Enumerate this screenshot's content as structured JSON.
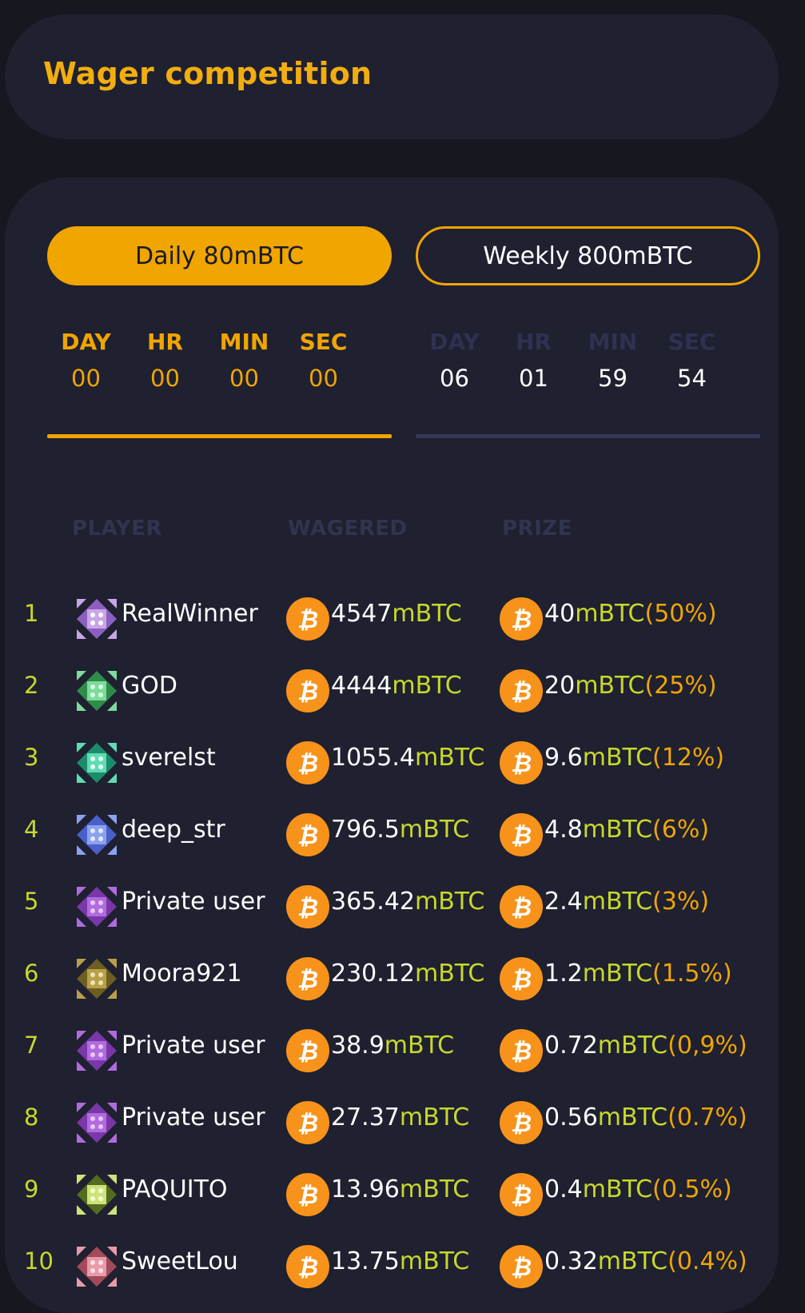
{
  "header": {
    "title": "Wager competition"
  },
  "tabs": [
    {
      "label": "Daily 80mBTC"
    },
    {
      "label": "Weekly 800mBTC"
    }
  ],
  "timers": {
    "daily": {
      "labels": [
        "DAY",
        "HR",
        "MIN",
        "SEC"
      ],
      "values": [
        "00",
        "00",
        "00",
        "00"
      ]
    },
    "weekly": {
      "labels": [
        "DAY",
        "HR",
        "MIN",
        "SEC"
      ],
      "values": [
        "06",
        "01",
        "59",
        "54"
      ]
    }
  },
  "columns": {
    "player": "PLAYER",
    "wagered": "WAGERED",
    "prize": "PRIZE"
  },
  "unit": "mBTC",
  "colors": {
    "accent": "#f0a500",
    "unit": "#c8d82a",
    "card": "#1f2030",
    "bg": "#16171f"
  },
  "leaderboard": [
    {
      "rank": "1",
      "name": "RealWinner",
      "wagered": "4547",
      "prize": "40",
      "pct": "(50%)",
      "avatar": "avatar-purple-pattern-icon"
    },
    {
      "rank": "2",
      "name": "GOD",
      "wagered": "4444",
      "prize": "20",
      "pct": "(25%)",
      "avatar": "avatar-green-pattern-icon"
    },
    {
      "rank": "3",
      "name": "sverelst",
      "wagered": "1055.4",
      "prize": "9.6",
      "pct": "(12%)",
      "avatar": "avatar-teal-pattern-icon"
    },
    {
      "rank": "4",
      "name": "deep_str",
      "wagered": "796.5",
      "prize": "4.8",
      "pct": "(6%)",
      "avatar": "avatar-blue-pattern-icon"
    },
    {
      "rank": "5",
      "name": "Private user",
      "wagered": "365.42",
      "prize": "2.4",
      "pct": "(3%)",
      "avatar": "avatar-violet-pattern-icon"
    },
    {
      "rank": "6",
      "name": "Moora921",
      "wagered": "230.12",
      "prize": "1.2",
      "pct": "(1.5%)",
      "avatar": "avatar-olive-pattern-icon"
    },
    {
      "rank": "7",
      "name": "Private user",
      "wagered": "38.9",
      "prize": "0.72",
      "pct": "(0,9%)",
      "avatar": "avatar-violet-pattern-icon"
    },
    {
      "rank": "8",
      "name": "Private user",
      "wagered": "27.37",
      "prize": "0.56",
      "pct": "(0.7%)",
      "avatar": "avatar-violet-pattern-icon"
    },
    {
      "rank": "9",
      "name": "PAQUITO",
      "wagered": "13.96",
      "prize": "0.4",
      "pct": "(0.5%)",
      "avatar": "avatar-lime-pattern-icon"
    },
    {
      "rank": "10",
      "name": "SweetLou",
      "wagered": "13.75",
      "prize": "0.32",
      "pct": "(0.4%)",
      "avatar": "avatar-pink-pattern-icon"
    }
  ]
}
